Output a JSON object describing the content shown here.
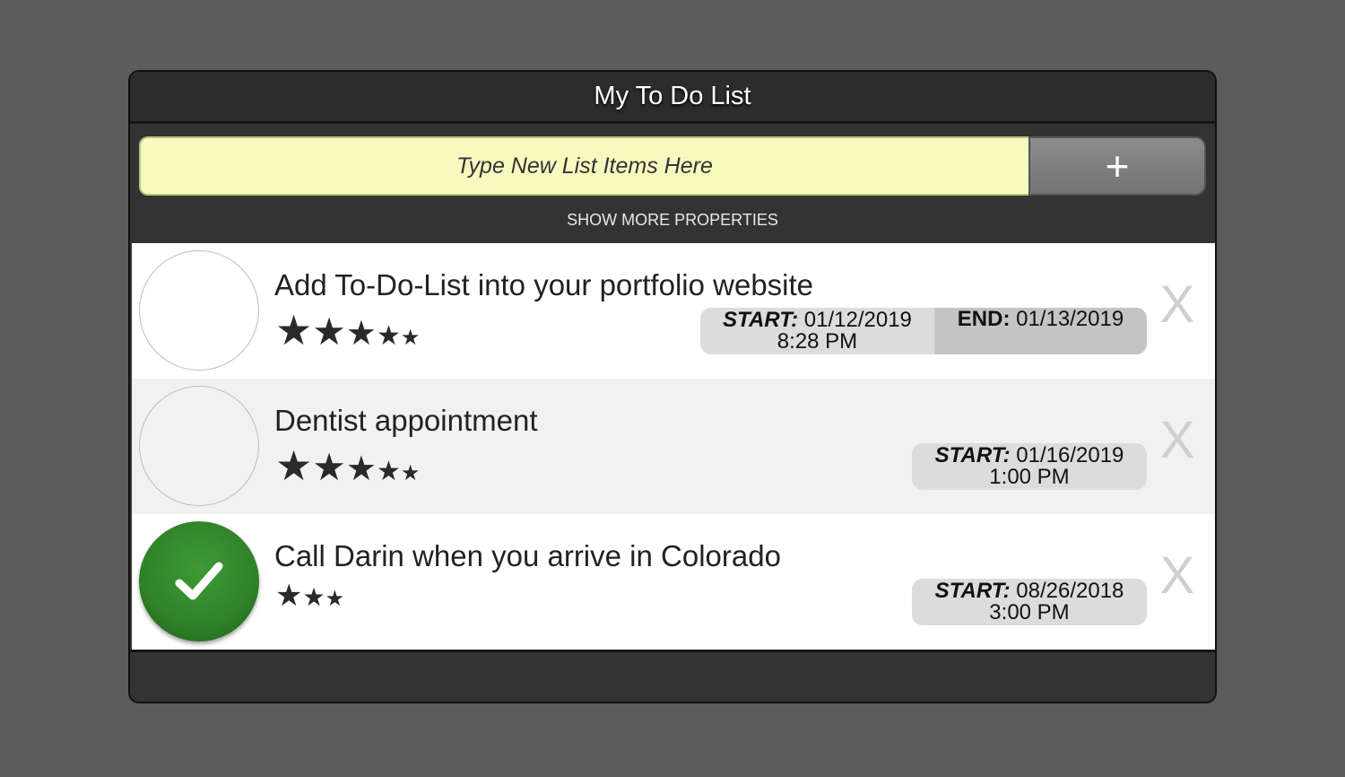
{
  "header": {
    "title": "My To Do List"
  },
  "input": {
    "placeholder": "Type New List Items Here",
    "add_label": "+"
  },
  "show_more": "SHOW MORE PROPERTIES",
  "delete_label": "X",
  "start_label": "START:",
  "end_label": "END:",
  "items": [
    {
      "text": "Add To-Do-List into your portfolio website",
      "rating": 5,
      "completed": false,
      "start_date": "01/12/2019",
      "start_time": "8:28 PM",
      "end_date": "01/13/2019"
    },
    {
      "text": "Dentist appointment",
      "rating": 5,
      "completed": false,
      "start_date": "01/16/2019",
      "start_time": "1:00 PM"
    },
    {
      "text": "Call Darin when you arrive in Colorado",
      "rating": 3,
      "completed": true,
      "start_date": "08/26/2018",
      "start_time": "3:00 PM"
    }
  ],
  "colors": {
    "accent_done": "#2f8228",
    "input_bg": "#f7f9bf",
    "frame": "#333333"
  },
  "icons": {
    "complete": "checkmark-icon",
    "rating": "star-icon",
    "delete": "x-icon",
    "add": "plus-icon"
  }
}
